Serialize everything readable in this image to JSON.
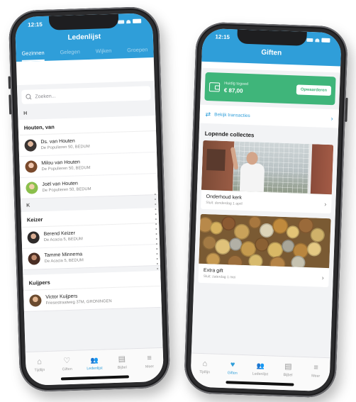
{
  "colors": {
    "primary": "#2f9ed9",
    "balance_green": "#3fb57a",
    "frame": "#2c2c2e"
  },
  "left_phone": {
    "status_time": "12:15",
    "title": "Ledenlijst",
    "tabs": [
      {
        "label": "Gezinnen",
        "active": true
      },
      {
        "label": "Gelegen",
        "active": false
      },
      {
        "label": "Wijken",
        "active": false
      },
      {
        "label": "Groepen",
        "active": false
      }
    ],
    "search_placeholder": "Zoeken...",
    "sections": [
      {
        "letter": "H"
      },
      {
        "letter": "K"
      }
    ],
    "families": [
      {
        "name": "Houten, van",
        "members": [
          {
            "name": "Ds. van Houten",
            "address": "De Populieren 50, BEDUM"
          },
          {
            "name": "Milou van Houten",
            "address": "De Populieren 50, BEDUM"
          },
          {
            "name": "Joël van Houten",
            "address": "De Populieren 50, BEDUM"
          }
        ]
      },
      {
        "name": "Keizer",
        "members": [
          {
            "name": "Berend Keizer",
            "address": "De Acacia 5, BEDUM"
          },
          {
            "name": "Tamme Minnema",
            "address": "De Acacia 5, BEDUM"
          }
        ]
      },
      {
        "name": "Kuijpers",
        "members": [
          {
            "name": "Victor Kuijpers",
            "address": "Friesestraatweg 37M, GRONINGEN"
          }
        ]
      }
    ],
    "nav": [
      {
        "label": "Tijdlijn",
        "icon": "home-icon",
        "glyph": "⌂"
      },
      {
        "label": "Giften",
        "icon": "heart-icon",
        "glyph": "♡"
      },
      {
        "label": "Ledenlijst",
        "icon": "people-icon",
        "glyph": "👥"
      },
      {
        "label": "Bijbel",
        "icon": "book-icon",
        "glyph": "▤"
      },
      {
        "label": "Meer",
        "icon": "menu-icon",
        "glyph": "≡"
      }
    ]
  },
  "right_phone": {
    "status_time": "12:15",
    "title": "Giften",
    "balance": {
      "label": "Huidig tegoed",
      "amount": "€ 87,00",
      "button": "Opwaarderen"
    },
    "transactions_label": "Bekijk transacties",
    "section_title": "Lopende collectes",
    "collections": [
      {
        "title": "Onderhoud kerk",
        "subtitle": "Sluit: donderdag 1 april"
      },
      {
        "title": "Extra gift",
        "subtitle": "Sluit: zaterdag 1 mei"
      }
    ],
    "nav": [
      {
        "label": "Tijdlijn",
        "icon": "home-icon",
        "glyph": "⌂"
      },
      {
        "label": "Giften",
        "icon": "heart-icon",
        "glyph": "♥"
      },
      {
        "label": "Ledenlijst",
        "icon": "people-icon",
        "glyph": "👥"
      },
      {
        "label": "Bijbel",
        "icon": "book-icon",
        "glyph": "▤"
      },
      {
        "label": "Meer",
        "icon": "menu-icon",
        "glyph": "≡"
      }
    ]
  }
}
